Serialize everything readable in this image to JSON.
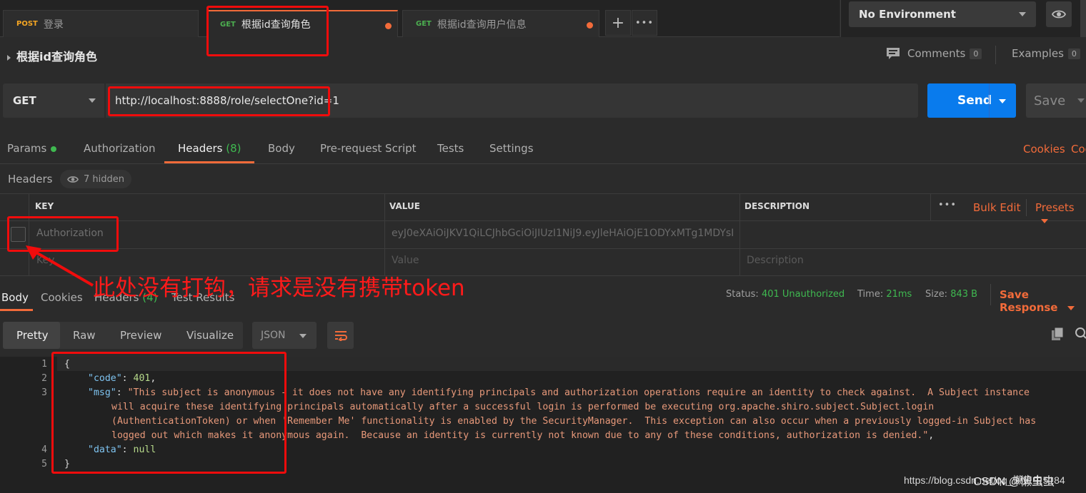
{
  "tabs": [
    {
      "method": "POST",
      "label": "登录"
    },
    {
      "method": "GET",
      "label": "根据id查询角色"
    },
    {
      "method": "GET",
      "label": "根据id查询用户信息"
    }
  ],
  "tab_actions": {
    "add": "+",
    "more": "•••"
  },
  "environment": {
    "selected": "No Environment"
  },
  "request": {
    "title": "根据id查询角色",
    "comments_label": "Comments",
    "comments_count": "0",
    "examples_label": "Examples",
    "examples_count": "0",
    "method": "GET",
    "url": "http://localhost:8888/role/selectOne?id=1",
    "send_label": "Send",
    "save_label": "Save"
  },
  "request_tabs": {
    "params": "Params",
    "authorization": "Authorization",
    "headers": "Headers",
    "headers_count": "(8)",
    "body": "Body",
    "prerequest": "Pre-request Script",
    "tests": "Tests",
    "settings": "Settings",
    "cookies": "Cookies",
    "code": "Coo"
  },
  "headers_section": {
    "label": "Headers",
    "hidden": "7 hidden",
    "col_key": "KEY",
    "col_value": "VALUE",
    "col_description": "DESCRIPTION",
    "more": "•••",
    "bulk_edit": "Bulk Edit",
    "presets": "Presets",
    "rows": [
      {
        "key": "Authorization",
        "value": "eyJ0eXAiOiJKV1QiLCJhbGciOiJIUzI1NiJ9.eyJleHAiOjE1ODYxMTg1MDYsI",
        "description": ""
      }
    ],
    "placeholder_key": "Key",
    "placeholder_value": "Value",
    "placeholder_description": "Description"
  },
  "response_tabs": {
    "body": "Body",
    "cookies": "Cookies",
    "headers": "Headers",
    "headers_count": "(4)",
    "test_results": "Test Results"
  },
  "response_status": {
    "status_label": "Status:",
    "status_value": "401 Unauthorized",
    "time_label": "Time:",
    "time_value": "21ms",
    "size_label": "Size:",
    "size_value": "843 B",
    "save_response": "Save Response"
  },
  "body_toolbar": {
    "pretty": "Pretty",
    "raw": "Raw",
    "preview": "Preview",
    "visualize": "Visualize",
    "format": "JSON"
  },
  "response_body": {
    "line_numbers": [
      "1",
      "2",
      "3",
      "",
      "",
      "",
      "4",
      "5"
    ],
    "open_brace": "{",
    "close_brace": "}",
    "code_key": "\"code\"",
    "code_value": "401",
    "msg_key": "\"msg\"",
    "msg_line1": "\"This subject is anonymous - it does not have any identifying principals and authorization operations require an identity to check against.  A Subject instance",
    "msg_line2": "will acquire these identifying principals automatically after a successful login is performed be executing org.apache.shiro.subject.Subject.login",
    "msg_line3": "(AuthenticationToken) or when 'Remember Me' functionality is enabled by the SecurityManager.  This exception can also occur when a previously logged-in Subject has",
    "msg_line4": "logged out which makes it anonymous again.  Because an identity is currently not known due to any of these conditions, authorization is denied.\"",
    "data_key": "\"data\"",
    "data_value": "null"
  },
  "annotation": {
    "text": "此处没有打钩，请求是没有携带token"
  },
  "watermark": "https://blog.csdn.net/qq_懒虫虫5184",
  "watermark_overlay": "CSDN @懒虫虫"
}
